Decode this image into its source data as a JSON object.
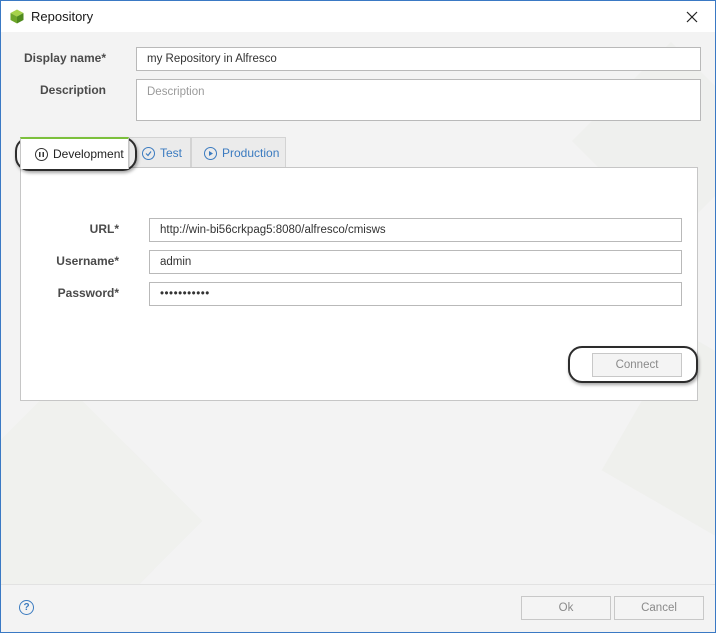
{
  "window": {
    "title": "Repository"
  },
  "form": {
    "display_name_label": "Display name*",
    "display_name_value": "my Repository in Alfresco",
    "description_label": "Description",
    "description_placeholder": "Description"
  },
  "tabs": [
    {
      "label": "Development",
      "state": "active",
      "icon": "pause-circle-icon"
    },
    {
      "label": "Test",
      "state": "inactive",
      "icon": "check-circle-icon"
    },
    {
      "label": "Production",
      "state": "inactive",
      "icon": "play-circle-icon"
    }
  ],
  "connection": {
    "url_label": "URL*",
    "url_value": "http://win-bi56crkpag5:8080/alfresco/cmisws",
    "username_label": "Username*",
    "username_value": "admin",
    "password_label": "Password*",
    "password_value": "•••••••••••",
    "connect_label": "Connect"
  },
  "footer": {
    "help_glyph": "?",
    "ok_label": "Ok",
    "cancel_label": "Cancel"
  },
  "colors": {
    "accent_blue": "#3b7bc0",
    "active_tab_green": "#7cc03c",
    "window_border": "#3a79c4"
  }
}
